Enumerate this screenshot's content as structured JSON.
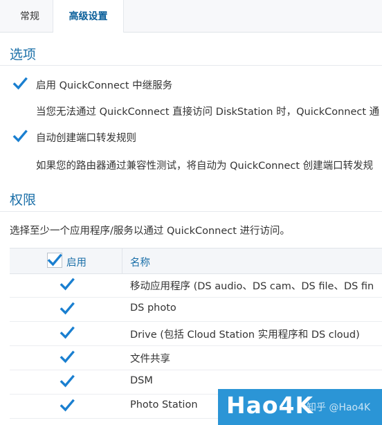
{
  "tabs": [
    {
      "label": "常规"
    },
    {
      "label": "高级设置"
    }
  ],
  "options": {
    "title": "选项",
    "items": [
      {
        "label": "启用 QuickConnect 中继服务",
        "checked": true,
        "description": "当您无法通过 QuickConnect 直接访问 DiskStation 时，QuickConnect 通"
      },
      {
        "label": "自动创建端口转发规则",
        "checked": true,
        "description": "如果您的路由器通过兼容性测试，将自动为 QuickConnect 创建端口转发规"
      }
    ]
  },
  "permissions": {
    "title": "权限",
    "description": "选择至少一个应用程序/服务以通过 QuickConnect 进行访问。",
    "columns": {
      "enable": "启用",
      "name": "名称"
    },
    "header_checked": true,
    "rows": [
      {
        "name": "移动应用程序 (DS audio、DS cam、DS file、DS fin",
        "checked": true
      },
      {
        "name": "DS photo",
        "checked": true
      },
      {
        "name": "Drive (包括 Cloud Station 实用程序和 DS cloud)",
        "checked": true
      },
      {
        "name": "文件共享",
        "checked": true
      },
      {
        "name": "DSM",
        "checked": true
      },
      {
        "name": "Photo Station",
        "checked": true
      }
    ]
  },
  "watermark": {
    "main": "Hao4K",
    "sub": "知乎 @Hao4K"
  },
  "colors": {
    "accent": "#1a6fa8",
    "check": "#1a7fd0",
    "watermark_bg": "#2b95d6"
  }
}
